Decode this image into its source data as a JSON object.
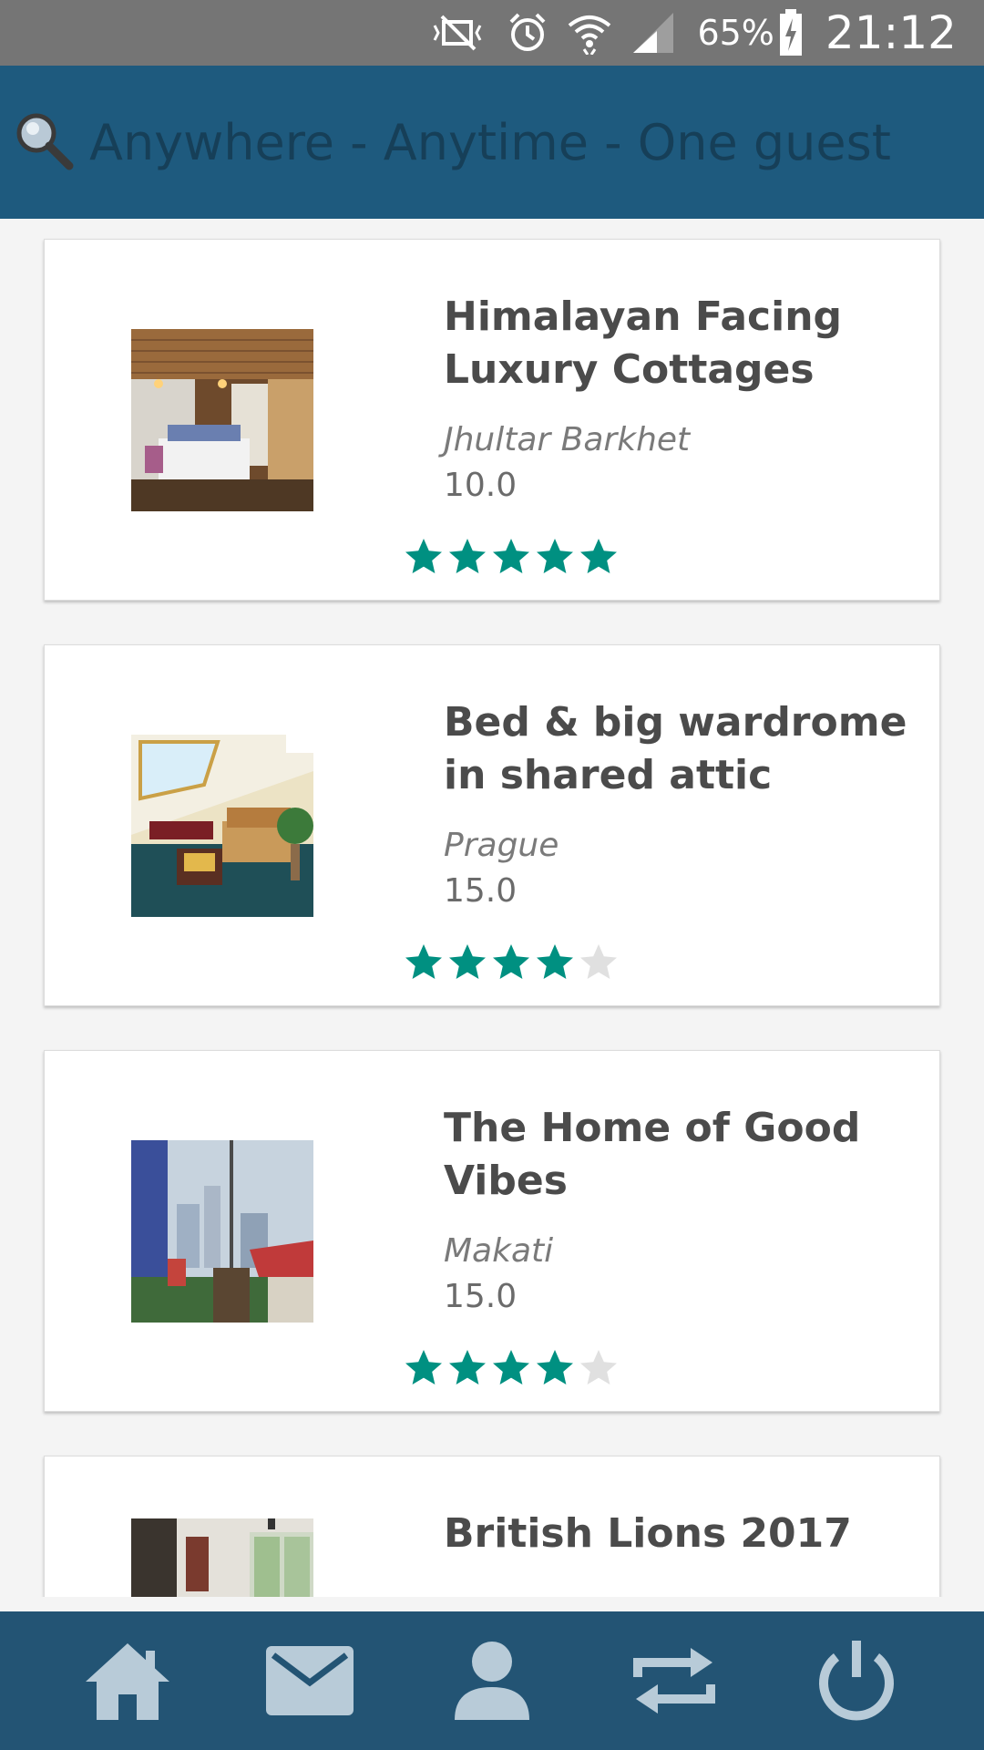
{
  "status_bar": {
    "battery_percent": "65%",
    "time": "21:12",
    "icons": [
      "vibrate-mute-icon",
      "alarm-icon",
      "wifi-icon",
      "cell-signal-icon",
      "battery-charging-icon"
    ]
  },
  "app_bar": {
    "search_text": "Anywhere - Anytime - One guest",
    "icon": "search-icon"
  },
  "listings": [
    {
      "title": "Himalayan Facing Luxury Cottages",
      "location": "Jhultar Barkhet",
      "price": "10.0",
      "rating": 5,
      "max_rating": 5
    },
    {
      "title": "Bed & big wardrome in shared attic",
      "location": "Prague",
      "price": "15.0",
      "rating": 4,
      "max_rating": 5
    },
    {
      "title": "The Home of Good Vibes",
      "location": "Makati",
      "price": "15.0",
      "rating": 4,
      "max_rating": 5
    },
    {
      "title": "British Lions 2017",
      "location": "",
      "price": "",
      "rating": 0,
      "max_rating": 5
    }
  ],
  "bottom_nav": {
    "items": [
      "home-icon",
      "mail-icon",
      "profile-icon",
      "swap-icon",
      "power-icon"
    ]
  },
  "colors": {
    "app_bar": "#1e5a7e",
    "bottom_nav": "#235474",
    "star_filled": "#009081",
    "star_empty": "#e0e0e0"
  }
}
